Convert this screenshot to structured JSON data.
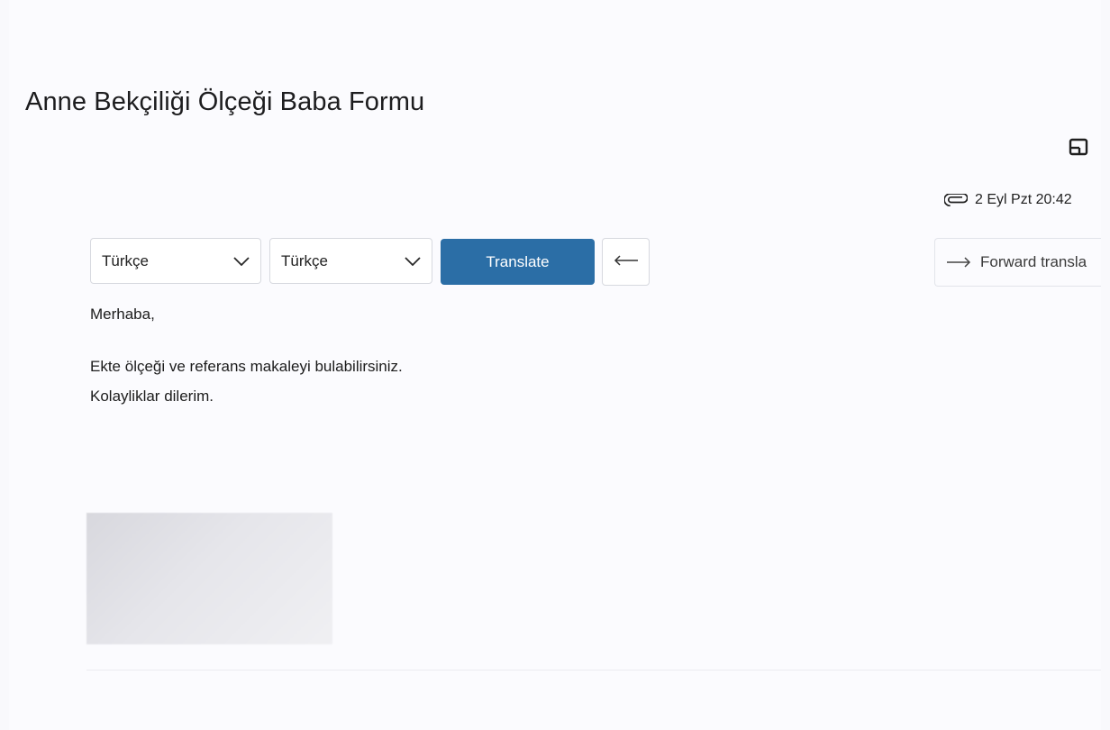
{
  "email": {
    "subject": "Anne Bekçiliği Ölçeği Baba Formu",
    "date": "2 Eyl Pzt 20:42",
    "body": {
      "greeting": "Merhaba,",
      "line1": "Ekte ölçeği ve referans makaleyi bulabilirsiniz.",
      "line2": "Kolayliklar dilerim."
    }
  },
  "translation": {
    "from_language": "Türkçe",
    "to_language": "Türkçe",
    "translate_label": "Translate",
    "forward_label": "Forward transla"
  },
  "icons": {
    "popout": "open-in-new-window-icon",
    "attachment": "paperclip-icon",
    "dropdown": "chevron-down-icon",
    "back": "arrow-left-icon",
    "forward": "arrow-right-icon"
  },
  "colors": {
    "primary_button": "#2b6ea6",
    "background": "#fbfbfe",
    "border": "#d7d9df"
  }
}
